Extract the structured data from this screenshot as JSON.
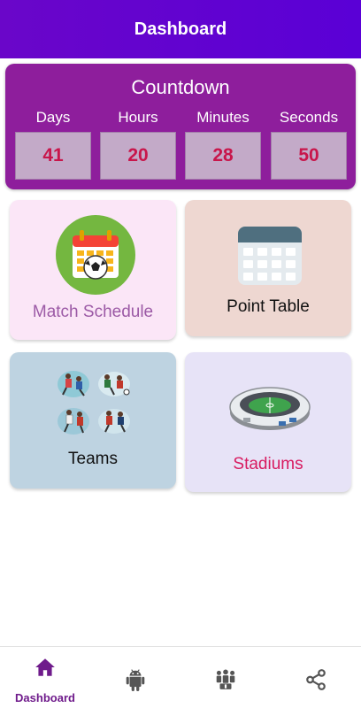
{
  "appbar": {
    "title": "Dashboard"
  },
  "countdown": {
    "title": "Countdown",
    "units": [
      {
        "label": "Days",
        "value": "41"
      },
      {
        "label": "Hours",
        "value": "20"
      },
      {
        "label": "Minutes",
        "value": "28"
      },
      {
        "label": "Seconds",
        "value": "50"
      }
    ]
  },
  "cards": [
    {
      "label": "Match Schedule",
      "icon": "calendar-football-icon",
      "label_color": "#9c5aa6"
    },
    {
      "label": "Point Table",
      "icon": "calendar-grid-icon",
      "label_color": "#111111"
    },
    {
      "label": "Teams",
      "icon": "players-icon",
      "label_color": "#111111"
    },
    {
      "label": "Stadiums",
      "icon": "stadium-icon",
      "label_color": "#d81b60"
    }
  ],
  "bottom_nav": [
    {
      "label": "Dashboard",
      "icon": "home-icon",
      "active": true
    },
    {
      "label": "",
      "icon": "android-icon",
      "active": false
    },
    {
      "label": "",
      "icon": "team-icon",
      "active": false
    },
    {
      "label": "",
      "icon": "share-icon",
      "active": false
    }
  ],
  "colors": {
    "appbar": "#6a06c9",
    "countdown_bg": "#8e1e9c",
    "countdown_value": "#c8164b",
    "nav_active": "#6f1b8b",
    "nav_inactive": "#555555"
  }
}
